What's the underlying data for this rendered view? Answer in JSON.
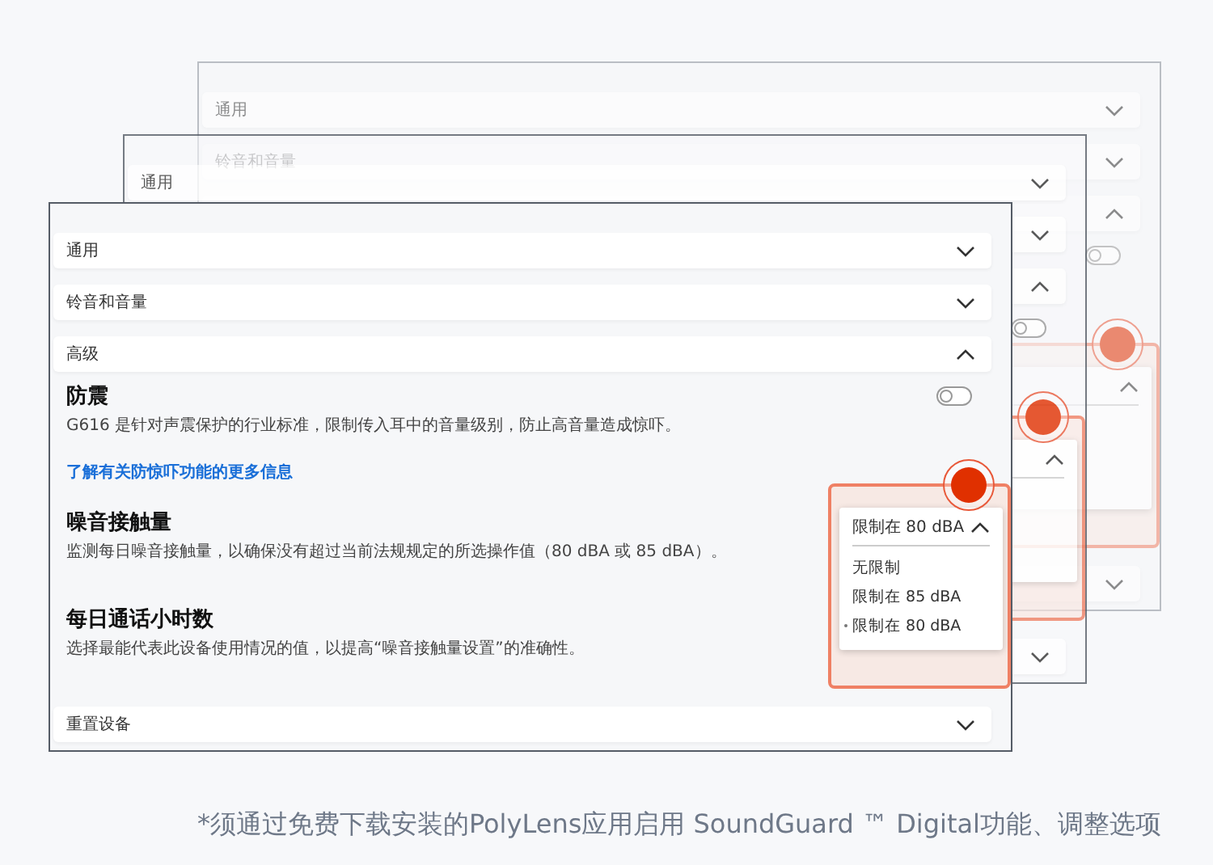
{
  "windows": [
    {
      "kind": "back",
      "rows": [
        {
          "label": "通用",
          "expanded": false
        },
        {
          "label": "铃音和音量",
          "expanded": false
        },
        {
          "expanded": true
        }
      ],
      "sections": [
        {
          "kind": "toggle",
          "on": false
        }
      ],
      "dropdown": {
        "expanded": true
      },
      "last_row": {
        "expanded": false
      }
    },
    {
      "kind": "middle",
      "rows": [
        {
          "label": "通用",
          "expanded": false
        },
        {
          "expanded": false
        },
        {
          "expanded": true
        }
      ],
      "sections": [
        {
          "kind": "toggle",
          "on": false
        }
      ],
      "dropdown": {
        "expanded": true
      },
      "last_row": {
        "expanded": false
      }
    },
    {
      "kind": "front",
      "rows": [
        {
          "label": "通用",
          "expanded": false
        },
        {
          "label": "铃音和音量",
          "expanded": false
        },
        {
          "label": "高级",
          "expanded": true
        }
      ],
      "sections": [
        {
          "kind": "toggle",
          "title": "防震",
          "description": "G616 是针对声震保护的行业标准，限制传入耳中的音量级别，防止高音量造成惊吓。",
          "on": false
        },
        {
          "kind": "link",
          "text": "了解有关防惊吓功能的更多信息"
        },
        {
          "kind": "setting",
          "title": "噪音接触量",
          "description": "监测每日噪音接触量，以确保没有超过当前法规规定的所选操作值（80 dBA 或 85 dBA）。"
        },
        {
          "kind": "setting",
          "title": "每日通话小时数",
          "description": "选择最能代表此设备使用情况的值，以提高“噪音接触量设置”的准确性。"
        }
      ],
      "dropdown": {
        "expanded": true,
        "value": "限制在 80 dBA",
        "options": [
          {
            "label": "无限制",
            "selected": false
          },
          {
            "label": "限制在 85 dBA",
            "selected": false
          },
          {
            "label": "限制在 80 dBA",
            "selected": true
          }
        ]
      },
      "last_row": {
        "label": "重置设备",
        "expanded": false
      }
    }
  ],
  "footnote": "*须通过免费下载安装的PolyLens应用启用 SoundGuard ™ Digital功能、调整选项"
}
